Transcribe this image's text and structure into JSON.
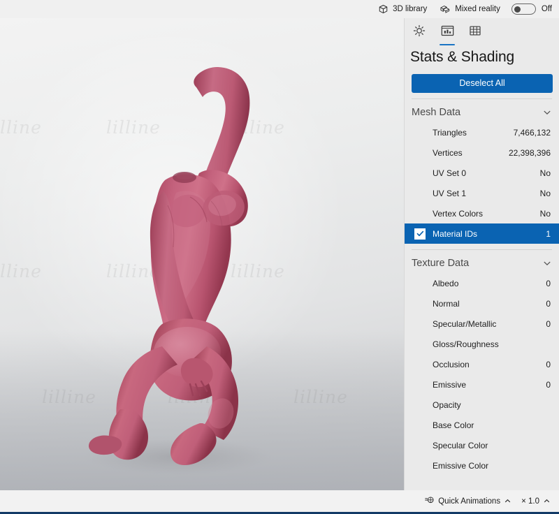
{
  "topbar": {
    "library_label": "3D library",
    "library_icon": "cube-icon",
    "mixed_reality_label": "Mixed reality",
    "mixed_reality_icon": "mixed-reality-icon",
    "mixed_reality_state": "Off"
  },
  "panel": {
    "tabs": [
      {
        "name": "lighting",
        "icon": "sun-icon",
        "active": false
      },
      {
        "name": "stats-shading",
        "icon": "chart-icon",
        "active": true
      },
      {
        "name": "grid",
        "icon": "grid-icon",
        "active": false
      }
    ],
    "title": "Stats & Shading",
    "deselect_label": "Deselect All",
    "accent_color": "#0a63b2",
    "sections": [
      {
        "name": "mesh-data",
        "title": "Mesh Data",
        "expanded": true,
        "rows": [
          {
            "label": "Triangles",
            "value": "7,466,132",
            "selected": false
          },
          {
            "label": "Vertices",
            "value": "22,398,396",
            "selected": false
          },
          {
            "label": "UV Set 0",
            "value": "No",
            "selected": false
          },
          {
            "label": "UV Set 1",
            "value": "No",
            "selected": false
          },
          {
            "label": "Vertex Colors",
            "value": "No",
            "selected": false
          },
          {
            "label": "Material IDs",
            "value": "1",
            "selected": true
          }
        ]
      },
      {
        "name": "texture-data",
        "title": "Texture Data",
        "expanded": true,
        "rows": [
          {
            "label": "Albedo",
            "value": "0",
            "selected": false
          },
          {
            "label": "Normal",
            "value": "0",
            "selected": false
          },
          {
            "label": "Specular/Metallic",
            "value": "0",
            "selected": false
          },
          {
            "label": "Gloss/Roughness",
            "value": "",
            "selected": false
          },
          {
            "label": "Occlusion",
            "value": "0",
            "selected": false
          },
          {
            "label": "Emissive",
            "value": "0",
            "selected": false
          },
          {
            "label": "Opacity",
            "value": "",
            "selected": false
          },
          {
            "label": "Base Color",
            "value": "",
            "selected": false
          },
          {
            "label": "Specular Color",
            "value": "",
            "selected": false
          },
          {
            "label": "Emissive Color",
            "value": "",
            "selected": false
          }
        ]
      }
    ]
  },
  "statusbar": {
    "animations_label": "Quick Animations",
    "animations_icon": "animation-icon",
    "speed_label": "× 1.0"
  },
  "viewport": {
    "model_color": "#c05c78",
    "model_shadow_color": "#8e3f57",
    "background_top": "#f3f3f3",
    "background_bottom": "#c9cacd",
    "watermark_text": "lilline"
  }
}
